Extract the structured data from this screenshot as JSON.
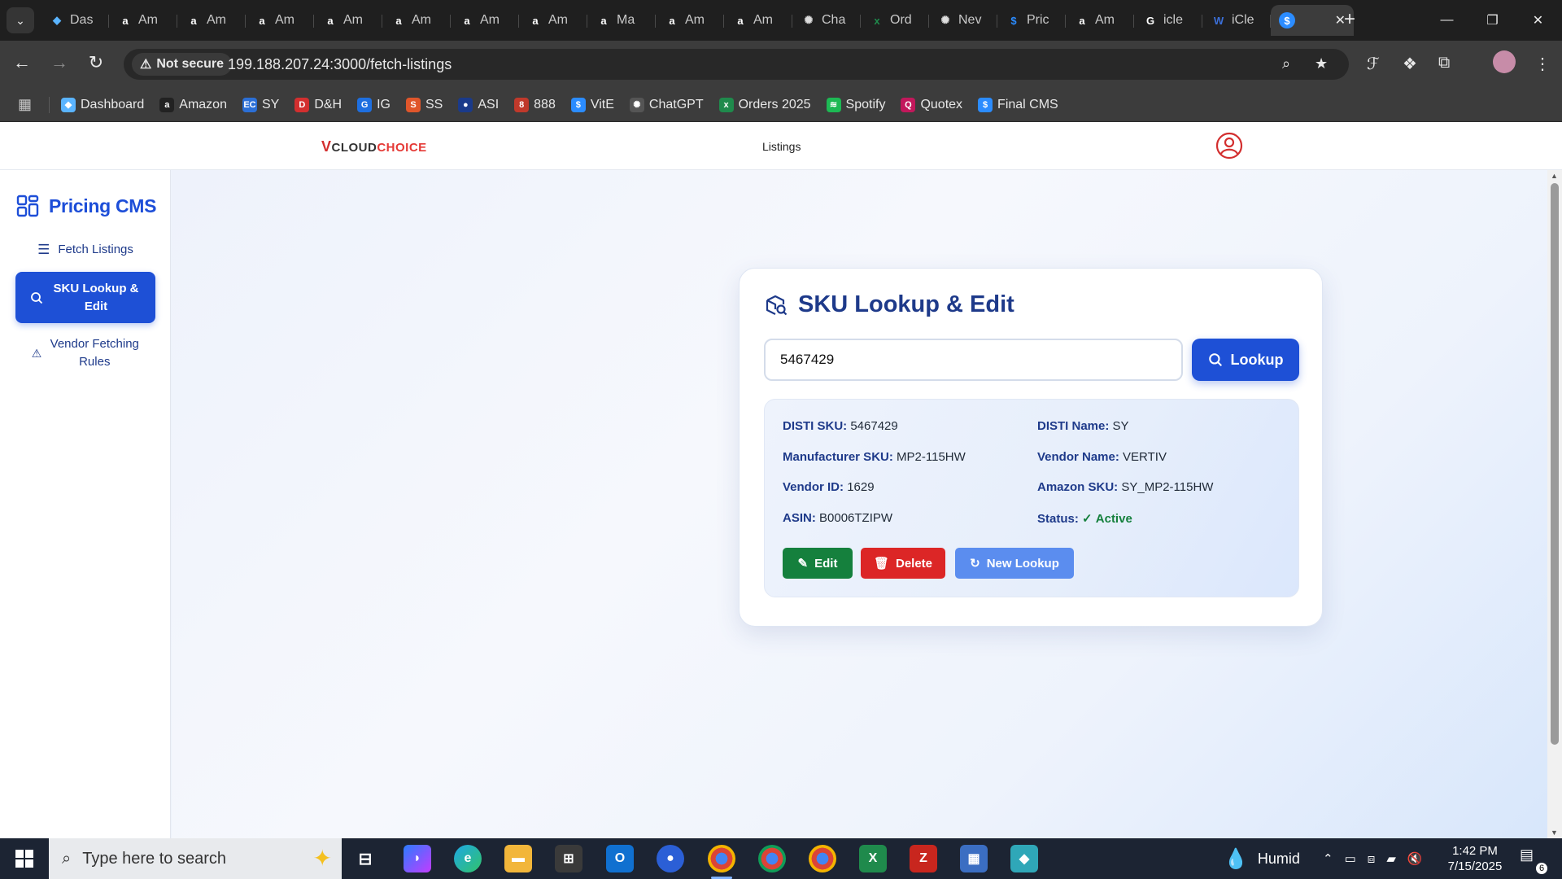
{
  "browser": {
    "tabs": [
      {
        "title": "Das",
        "icon": "cloud-favicon",
        "color": "#5ab4ff",
        "glyph": "◆"
      },
      {
        "title": "Am",
        "icon": "amazon-favicon",
        "color": "#ffffff",
        "glyph": "a"
      },
      {
        "title": "Am",
        "icon": "amazon-favicon",
        "color": "#ffffff",
        "glyph": "a"
      },
      {
        "title": "Am",
        "icon": "amazon-favicon",
        "color": "#ffffff",
        "glyph": "a"
      },
      {
        "title": "Am",
        "icon": "amazon-favicon",
        "color": "#ffffff",
        "glyph": "a"
      },
      {
        "title": "Am",
        "icon": "amazon-favicon",
        "color": "#ffffff",
        "glyph": "a"
      },
      {
        "title": "Am",
        "icon": "amazon-favicon",
        "color": "#ffffff",
        "glyph": "a"
      },
      {
        "title": "Am",
        "icon": "amazon-favicon",
        "color": "#ffffff",
        "glyph": "a"
      },
      {
        "title": "Ma",
        "icon": "amazon-favicon",
        "color": "#ffffff",
        "glyph": "a"
      },
      {
        "title": "Am",
        "icon": "amazon-favicon",
        "color": "#ffffff",
        "glyph": "a"
      },
      {
        "title": "Am",
        "icon": "amazon-favicon",
        "color": "#ffffff",
        "glyph": "a"
      },
      {
        "title": "Cha",
        "icon": "chatgpt-favicon",
        "color": "#dddddd",
        "glyph": "✺"
      },
      {
        "title": "Ord",
        "icon": "excel-favicon",
        "color": "#1f8a4c",
        "glyph": "x"
      },
      {
        "title": "Nev",
        "icon": "chatgpt-favicon",
        "color": "#dddddd",
        "glyph": "✺"
      },
      {
        "title": "Pric",
        "icon": "dollar-favicon",
        "color": "#2b8cff",
        "glyph": "$"
      },
      {
        "title": "Am",
        "icon": "amazon-favicon",
        "color": "#ffffff",
        "glyph": "a"
      },
      {
        "title": "icle",
        "icon": "google-favicon",
        "color": "#ffffff",
        "glyph": "G"
      },
      {
        "title": "iCle",
        "icon": "wordpress-favicon",
        "color": "#3b6fd8",
        "glyph": "W"
      }
    ],
    "active_tab": {
      "icon": "dollar-favicon",
      "color": "#2b8cff",
      "glyph": "$",
      "close": "✕"
    },
    "new_tab": "+",
    "security_label": "Not secure",
    "url": "199.188.207.24:3000/fetch-listings",
    "bookmarks": [
      {
        "label": "Dashboard",
        "icon": "cloud-favicon",
        "color": "#5ab4ff",
        "glyph": "◆"
      },
      {
        "label": "Amazon",
        "icon": "amazon-favicon",
        "color": "#222222",
        "glyph": "a"
      },
      {
        "label": "SY",
        "icon": "ec-favicon",
        "color": "#2b6fd6",
        "glyph": "EC"
      },
      {
        "label": "D&H",
        "icon": "dh-favicon",
        "color": "#d32f2f",
        "glyph": "D"
      },
      {
        "label": "IG",
        "icon": "ig-favicon",
        "color": "#1e6fe0",
        "glyph": "G"
      },
      {
        "label": "SS",
        "icon": "ss-favicon",
        "color": "#e0562b",
        "glyph": "S"
      },
      {
        "label": "ASI",
        "icon": "asi-favicon",
        "color": "#1a3a8a",
        "glyph": "●"
      },
      {
        "label": "888",
        "icon": "888-favicon",
        "color": "#c0392b",
        "glyph": "8"
      },
      {
        "label": "VitE",
        "icon": "dollar-favicon",
        "color": "#2b8cff",
        "glyph": "$"
      },
      {
        "label": "ChatGPT",
        "icon": "chatgpt-favicon",
        "color": "#555555",
        "glyph": "✺"
      },
      {
        "label": "Orders 2025",
        "icon": "excel-favicon",
        "color": "#1f8a4c",
        "glyph": "x"
      },
      {
        "label": "Spotify",
        "icon": "spotify-favicon",
        "color": "#1db954",
        "glyph": "≋"
      },
      {
        "label": "Quotex",
        "icon": "quotex-favicon",
        "color": "#c2185b",
        "glyph": "Q"
      },
      {
        "label": "Final CMS",
        "icon": "dollar-favicon",
        "color": "#2b8cff",
        "glyph": "$"
      }
    ]
  },
  "app": {
    "logo_v": "V",
    "logo_cloud": "CLOUD",
    "logo_choice": "CHOICE",
    "nav_link": "Listings",
    "sidebar": {
      "brand": "Pricing CMS",
      "items": [
        {
          "label": "Fetch Listings",
          "icon": "list-icon"
        },
        {
          "label": "SKU Lookup & Edit",
          "icon": "search-icon",
          "active": true
        },
        {
          "label": "Vendor Fetching Rules",
          "icon": "warning-icon"
        }
      ]
    },
    "card": {
      "title": "SKU Lookup & Edit",
      "input_value": "5467429",
      "lookup_label": "Lookup",
      "fields": {
        "disti_sku_label": "DISTI SKU:",
        "disti_sku": "5467429",
        "disti_name_label": "DISTI Name:",
        "disti_name": "SY",
        "mfr_sku_label": "Manufacturer SKU:",
        "mfr_sku": "MP2-115HW",
        "vendor_name_label": "Vendor Name:",
        "vendor_name": "VERTIV",
        "vendor_id_label": "Vendor ID:",
        "vendor_id": "1629",
        "amazon_sku_label": "Amazon SKU:",
        "amazon_sku": "SY_MP2-115HW",
        "asin_label": "ASIN:",
        "asin": "B0006TZIPW",
        "status_label": "Status:",
        "status": "Active"
      },
      "edit_label": "Edit",
      "delete_label": "Delete",
      "new_lookup_label": "New Lookup"
    }
  },
  "taskbar": {
    "search_placeholder": "Type here to search",
    "weather": "Humid",
    "time": "1:42 PM",
    "date": "7/15/2025",
    "notification_count": "6"
  },
  "colors": {
    "primary": "#1e50d6",
    "success": "#15803d",
    "danger": "#dc2626",
    "secondary_button": "#5b8def",
    "heading": "#1e3a8a"
  }
}
